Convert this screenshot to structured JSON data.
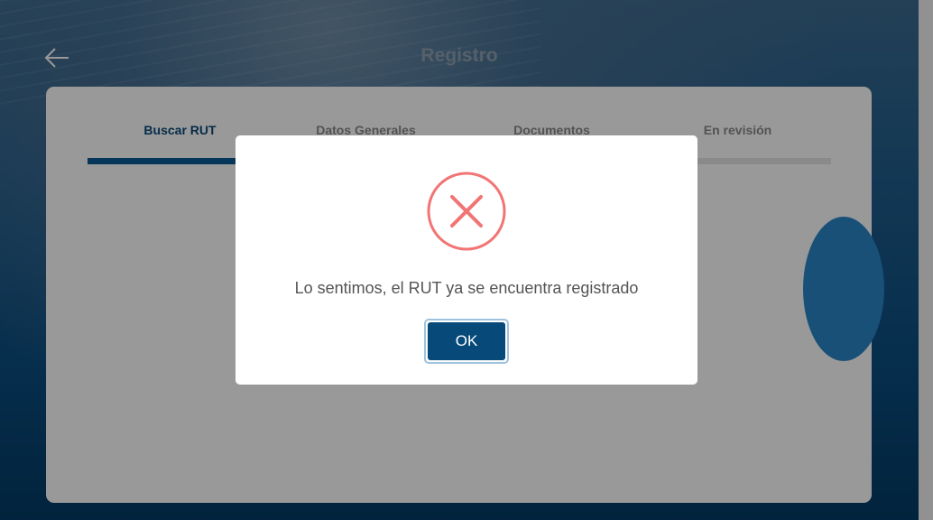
{
  "header": {
    "title": "Registro",
    "back_icon": "arrow-left-icon"
  },
  "steps": [
    {
      "label": "Buscar RUT",
      "state": "active"
    },
    {
      "label": "Datos Generales",
      "state": "pending"
    },
    {
      "label": "Documentos",
      "state": "pending"
    },
    {
      "label": "En revisión",
      "state": "pending"
    }
  ],
  "dialog": {
    "icon": "error-x-icon",
    "message": "Lo sentimos, el RUT ya se encuentra registrado",
    "ok_label": "OK"
  },
  "colors": {
    "accent": "#074a7a",
    "error": "#f27474",
    "overlay": "rgba(0,0,0,0.4)"
  }
}
